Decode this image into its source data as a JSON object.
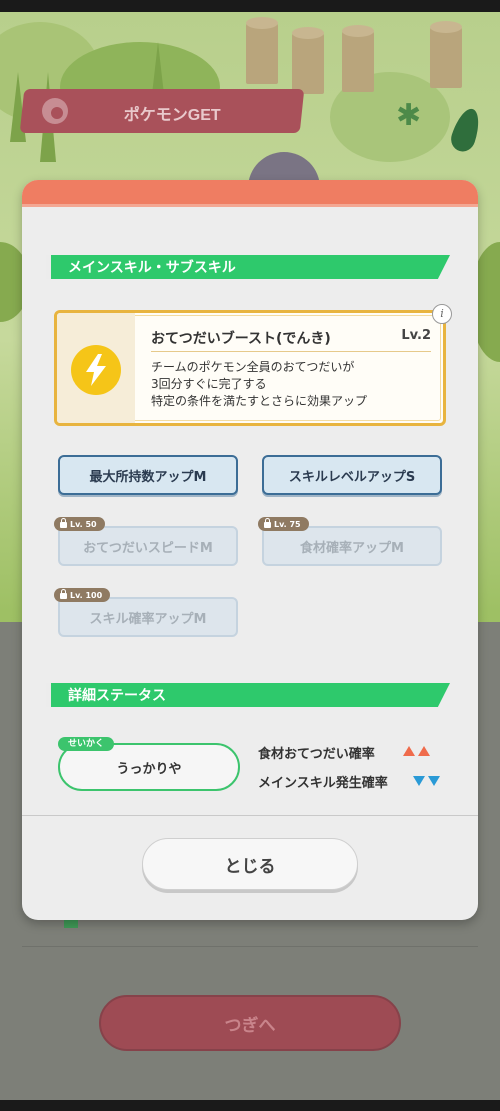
{
  "background": {
    "get_banner": {
      "label": "ポケモンGET",
      "icon": "pokeball-icon"
    },
    "next_button": {
      "label": "つぎへ"
    }
  },
  "modal": {
    "header_color": "#ef7d62",
    "skills_section": {
      "title": "メインスキル・サブスキル",
      "main_skill": {
        "name": "おてつだいブースト(でんき)",
        "level": "Lv.2",
        "icon": "lightning-icon",
        "description": [
          "チームのポケモン全員のおてつだいが",
          "3回分すぐに完了する",
          "特定の条件を満たすとさらに効果アップ"
        ]
      },
      "sub_skills": [
        {
          "label": "最大所持数アップM",
          "locked": false,
          "unlock_level": ""
        },
        {
          "label": "スキルレベルアップS",
          "locked": false,
          "unlock_level": ""
        },
        {
          "label": "おてつだいスピードM",
          "locked": true,
          "unlock_level": "Lv. 50"
        },
        {
          "label": "食材確率アップM",
          "locked": true,
          "unlock_level": "Lv. 75"
        },
        {
          "label": "スキル確率アップM",
          "locked": true,
          "unlock_level": "Lv. 100"
        }
      ]
    },
    "status_section": {
      "title": "詳細ステータス",
      "nature_tag": "せいかく",
      "nature_value": "うっかりや",
      "stats": [
        {
          "label": "食材おてつだい確率",
          "effect": "up",
          "color": "#ef6b4b"
        },
        {
          "label": "メインスキル発生確率",
          "effect": "down",
          "color": "#2a9ad6"
        }
      ]
    },
    "close_button": {
      "label": "とじる"
    }
  }
}
